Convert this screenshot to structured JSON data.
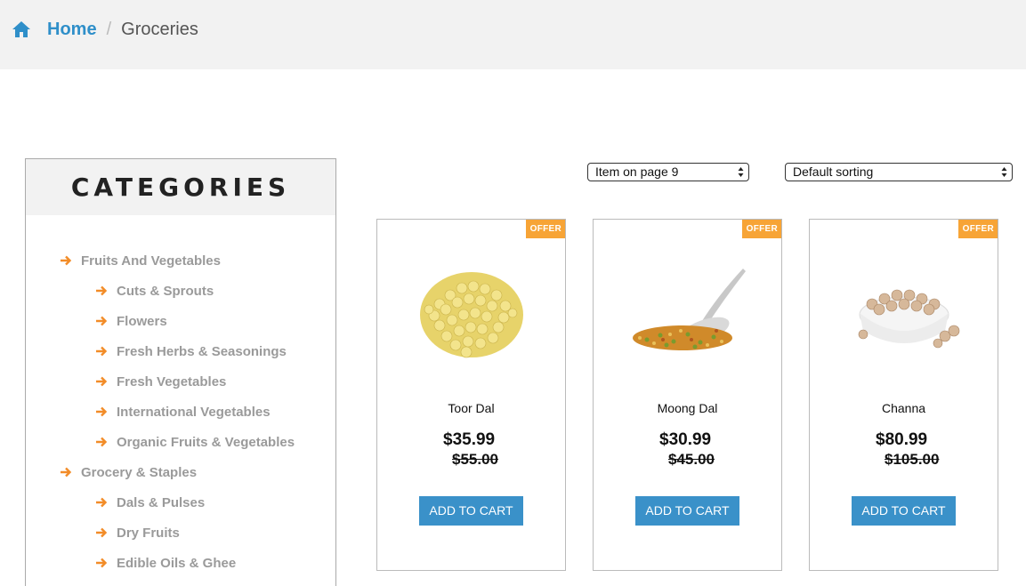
{
  "breadcrumb": {
    "home_label": "Home",
    "separator": "/",
    "current": "Groceries",
    "home_icon": "home-icon"
  },
  "sidebar": {
    "title": "CATEGORIES",
    "items": [
      {
        "label": "Fruits And Vegetables",
        "level": 1
      },
      {
        "label": "Cuts & Sprouts",
        "level": 2
      },
      {
        "label": "Flowers",
        "level": 2
      },
      {
        "label": "Fresh Herbs & Seasonings",
        "level": 2
      },
      {
        "label": "Fresh Vegetables",
        "level": 2
      },
      {
        "label": "International Vegetables",
        "level": 2
      },
      {
        "label": "Organic Fruits & Vegetables",
        "level": 2
      },
      {
        "label": "Grocery & Staples",
        "level": 1
      },
      {
        "label": "Dals & Pulses",
        "level": 2
      },
      {
        "label": "Dry Fruits",
        "level": 2
      },
      {
        "label": "Edible Oils & Ghee",
        "level": 2
      }
    ]
  },
  "controls": {
    "items_per_page": "Item on page 9",
    "sorting": "Default sorting"
  },
  "products": [
    {
      "badge": "OFFER",
      "name": "Toor Dal",
      "price": "$35.99",
      "old_price": "$55.00",
      "button": "ADD TO CART"
    },
    {
      "badge": "OFFER",
      "name": "Moong Dal",
      "price": "$30.99",
      "old_price": "$45.00",
      "button": "ADD TO CART"
    },
    {
      "badge": "OFFER",
      "name": "Channa",
      "price": "$80.99",
      "old_price": "$105.00",
      "button": "ADD TO CART"
    }
  ],
  "colors": {
    "accent": "#3a91c9",
    "offer": "#f7a436",
    "arrow": "#f28c28"
  }
}
